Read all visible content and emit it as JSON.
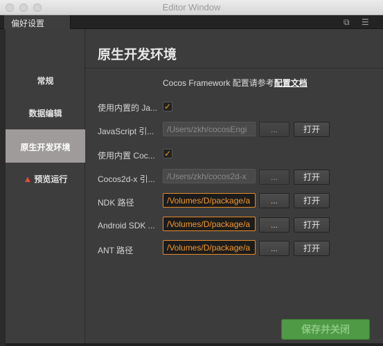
{
  "window": {
    "title": "Editor Window"
  },
  "tab": {
    "label": "偏好设置"
  },
  "sidebar": {
    "items": [
      {
        "label": "常规"
      },
      {
        "label": "数据编辑"
      },
      {
        "label": "原生开发环境"
      },
      {
        "label": "预览运行"
      }
    ]
  },
  "main": {
    "title": "原生开发环境",
    "intro_text": "Cocos Framework 配置请参考",
    "intro_link": "配置文档",
    "rows": [
      {
        "label": "使用内置的 Ja...",
        "type": "checkbox",
        "checked": true
      },
      {
        "label": "JavaScript 引...",
        "path": "/Users/zkh/cocosEngi",
        "dots": "...",
        "open": "打开"
      },
      {
        "label": "使用内置 Coc...",
        "type": "checkbox",
        "checked": true
      },
      {
        "label": "Cocos2d-x 引...",
        "path": "/Users/zkh/cocos2d-x",
        "dots": "...",
        "open": "打开"
      },
      {
        "label": "NDK 路径",
        "path": "/Volumes/D/package/a",
        "dots": "...",
        "open": "打开"
      },
      {
        "label": "Android SDK ...",
        "path": "/Volumes/D/package/a",
        "dots": "...",
        "open": "打开"
      },
      {
        "label": "ANT 路径",
        "path": "/Volumes/D/package/a",
        "dots": "...",
        "open": "打开"
      }
    ],
    "save_label": "保存并关闭"
  },
  "colors": {
    "accent": "#f59a30",
    "save": "#4f9a45",
    "active_sidebar": "#a09b9b",
    "warning": "#e84c3d"
  }
}
